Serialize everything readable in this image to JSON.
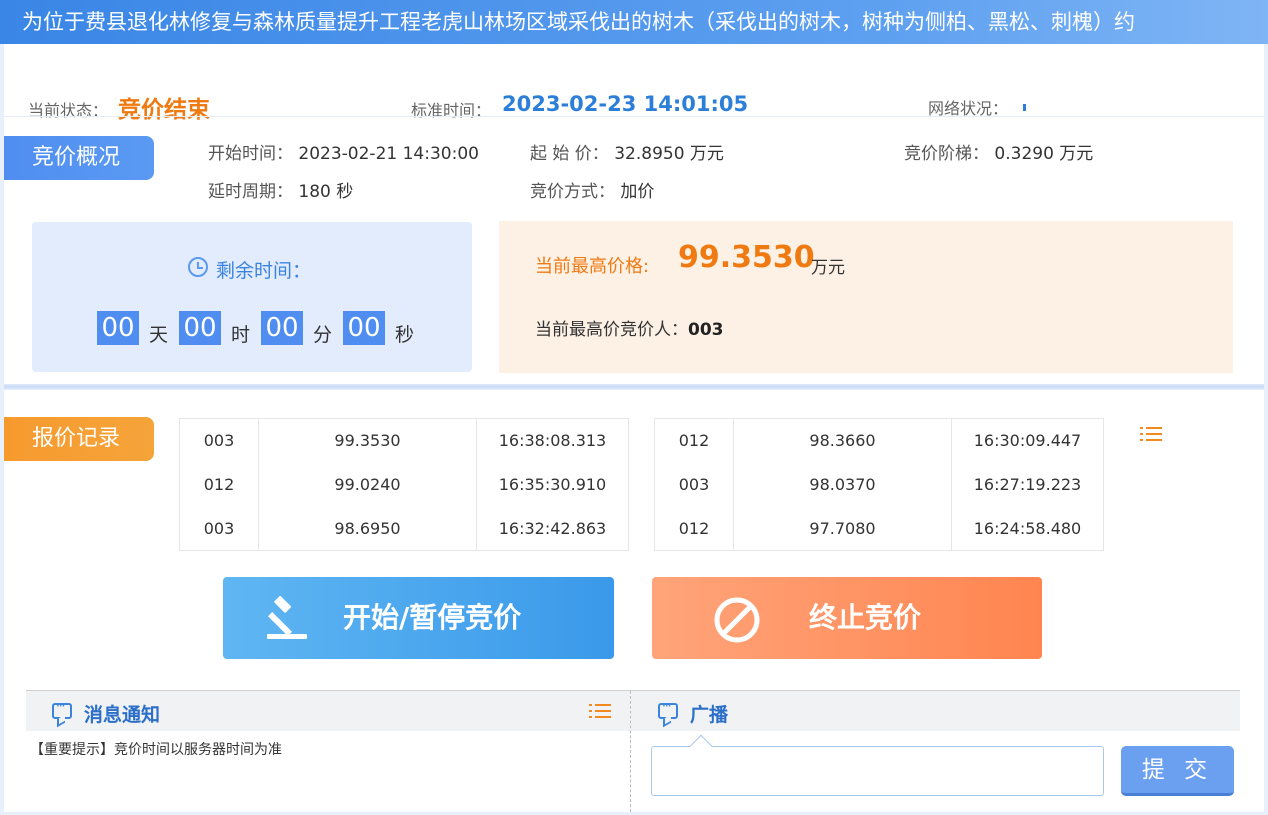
{
  "title": "为位于费县退化林修复与森林质量提升工程老虎山林场区域采伐出的树木（采伐出的树木，树种为侧柏、黑松、刺槐）约",
  "status": {
    "status_label": "当前状态：",
    "status_value": "竞价结束",
    "time_label": "标准时间：",
    "time_value": "2023-02-23 14:01:05",
    "network_label": "网络状况："
  },
  "overview": {
    "tag": "竞价概况",
    "start_time_label": "开始时间：",
    "start_time_value": "2023-02-21 14:30:00",
    "start_price_label": "起 始 价：",
    "start_price_value": "32.8950 万元",
    "step_label": "竞价阶梯：",
    "step_value": "0.3290 万元",
    "delay_label": "延时周期：",
    "delay_value": "180 秒",
    "method_label": "竞价方式：",
    "method_value": "加价"
  },
  "countdown": {
    "label": "剩余时间：",
    "days": "00",
    "days_unit": "天",
    "hours": "00",
    "hours_unit": "时",
    "minutes": "00",
    "minutes_unit": "分",
    "seconds": "00",
    "seconds_unit": "秒"
  },
  "highest": {
    "price_label": "当前最高价格:",
    "price_value": "99.3530",
    "price_unit": "万元",
    "bidder_label": "当前最高价竞价人：",
    "bidder_value": "003"
  },
  "records": {
    "tag": "报价记录",
    "left": [
      {
        "bidder": "003",
        "price": "99.3530",
        "time": "16:38:08.313"
      },
      {
        "bidder": "012",
        "price": "99.0240",
        "time": "16:35:30.910"
      },
      {
        "bidder": "003",
        "price": "98.6950",
        "time": "16:32:42.863"
      }
    ],
    "right": [
      {
        "bidder": "012",
        "price": "98.3660",
        "time": "16:30:09.447"
      },
      {
        "bidder": "003",
        "price": "98.0370",
        "time": "16:27:19.223"
      },
      {
        "bidder": "012",
        "price": "97.7080",
        "time": "16:24:58.480"
      }
    ]
  },
  "actions": {
    "start_pause": "开始/暂停竞价",
    "stop": "终止竞价"
  },
  "notice": {
    "title": "消息通知",
    "message": "【重要提示】竞价时间以服务器时间为准"
  },
  "broadcast": {
    "title": "广播",
    "input_value": "",
    "submit": "提 交"
  },
  "icons": {
    "clock": "clock-icon",
    "list": "list-icon",
    "gavel": "gavel-icon",
    "forbidden": "forbidden-icon",
    "chat": "chat-icon"
  },
  "colors": {
    "accent_blue": "#4f8ef0",
    "accent_orange": "#f07a12",
    "stop_orange": "#ff8550"
  }
}
